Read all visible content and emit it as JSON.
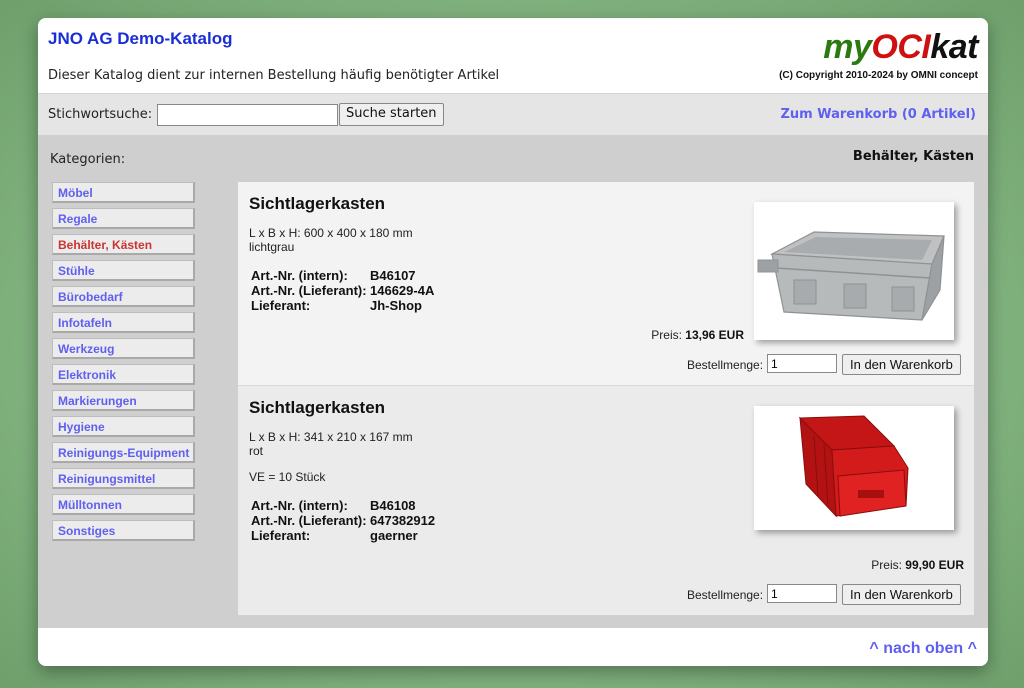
{
  "header": {
    "catalog_title": "JNO AG Demo-Katalog",
    "catalog_subtitle": "Dieser Katalog dient zur internen Bestellung häufig benötigter Artikel",
    "logo_part1": "my",
    "logo_part2": "OCI",
    "logo_part3": "kat",
    "copyright": "(C) Copyright 2010-2024 by OMNI concept"
  },
  "search": {
    "label": "Stichwortsuche:",
    "value": "",
    "placeholder": "",
    "button_label": "Suche starten",
    "cart_link": "Zum Warenkorb (0 Artikel)"
  },
  "sidebar": {
    "label": "Kategorien:",
    "current_category": "Behälter, Kästen",
    "items": [
      {
        "label": "Möbel"
      },
      {
        "label": "Regale"
      },
      {
        "label": "Behälter, Kästen",
        "active": true
      },
      {
        "label": "Stühle"
      },
      {
        "label": "Bürobedarf"
      },
      {
        "label": "Infotafeln"
      },
      {
        "label": "Werkzeug"
      },
      {
        "label": "Elektronik"
      },
      {
        "label": "Markierungen"
      },
      {
        "label": "Hygiene"
      },
      {
        "label": "Reinigungs-Equipment"
      },
      {
        "label": "Reinigungsmittel"
      },
      {
        "label": "Mülltonnen"
      },
      {
        "label": "Sonstiges"
      }
    ]
  },
  "products": [
    {
      "title": "Sichtlagerkasten",
      "dimensions": "L x B x H: 600 x 400 x 180 mm",
      "color": "lichtgrau",
      "ve": "",
      "art_intern_label": "Art.-Nr. (intern):",
      "art_intern": "B46107",
      "art_supplier_label": "Art.-Nr. (Lieferant):",
      "art_supplier": "146629-4A",
      "supplier_label": "Lieferant:",
      "supplier": "Jh-Shop",
      "price_label": "Preis:",
      "price": "13,96 EUR",
      "qty_label": "Bestellmenge:",
      "qty_value": "1",
      "cart_button": "In den Warenkorb",
      "image_icon": "gray-storage-box-icon"
    },
    {
      "title": "Sichtlagerkasten",
      "dimensions": "L x B x H: 341 x 210 x 167 mm",
      "color": "rot",
      "ve": "VE = 10 Stück",
      "art_intern_label": "Art.-Nr. (intern):",
      "art_intern": "B46108",
      "art_supplier_label": "Art.-Nr. (Lieferant):",
      "art_supplier": "647382912",
      "supplier_label": "Lieferant:",
      "supplier": "gaerner",
      "price_label": "Preis:",
      "price": "99,90 EUR",
      "qty_label": "Bestellmenge:",
      "qty_value": "1",
      "cart_button": "In den Warenkorb",
      "image_icon": "red-storage-bin-icon"
    }
  ],
  "footer": {
    "to_top": "^ nach oben ^"
  },
  "colors": {
    "link": "#5f5ff0",
    "title_blue": "#1a2ed6",
    "active_category": "#cc3333",
    "logo_green": "#2a7a10",
    "logo_red": "#d01010"
  }
}
